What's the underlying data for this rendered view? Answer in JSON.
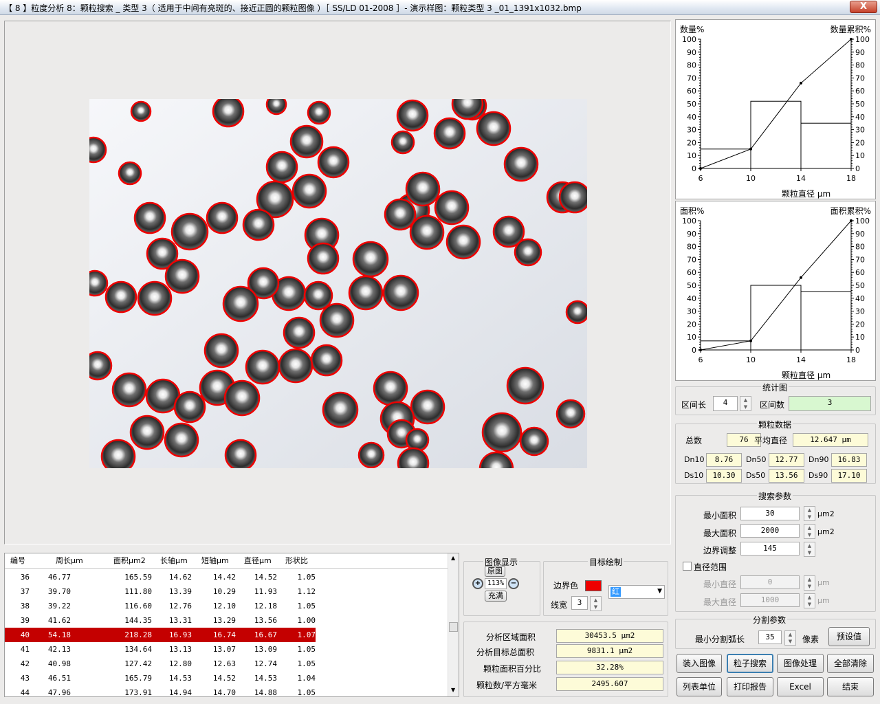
{
  "window": {
    "title": "【 8 】粒度分析 8：颗粒搜索 _ 类型 3（ 适用于中间有亮斑的、接近正圆的颗粒图像 ）［  SS/LD 01-2008  ］- 演示样图：颗粒类型 3 _01_1391x1032.bmp",
    "close": "X"
  },
  "charts": {
    "count": {
      "ylabel_left": "数量%",
      "ylabel_right": "数量累积%",
      "xlabel": "颗粒直径  μm"
    },
    "area": {
      "ylabel_left": "面积%",
      "ylabel_right": "面积累积%",
      "xlabel": "颗粒直径  μm"
    }
  },
  "chart_data": [
    {
      "type": "bar",
      "x_edges": [
        6,
        10,
        14,
        18
      ],
      "values": [
        15,
        52,
        35
      ],
      "cumulative": [
        0,
        15,
        66,
        100
      ],
      "xlim": [
        6,
        18
      ],
      "ylim": [
        0,
        100
      ],
      "xticks": [
        "6",
        "10",
        "14",
        "18"
      ],
      "yticks": [
        "0",
        "10",
        "20",
        "30",
        "40",
        "50",
        "60",
        "70",
        "80",
        "90",
        "100"
      ]
    },
    {
      "type": "bar",
      "x_edges": [
        6,
        10,
        14,
        18
      ],
      "values": [
        7,
        50,
        45
      ],
      "cumulative": [
        0,
        7,
        56,
        100
      ],
      "xlim": [
        6,
        18
      ],
      "ylim": [
        0,
        100
      ],
      "xticks": [
        "6",
        "10",
        "14",
        "18"
      ],
      "yticks": [
        "0",
        "10",
        "20",
        "30",
        "40",
        "50",
        "60",
        "70",
        "80",
        "90",
        "100"
      ]
    }
  ],
  "stats": {
    "title": "统计图",
    "interval_label": "区间长",
    "interval_value": "4",
    "count_label": "区间数",
    "count_value": "3"
  },
  "particle": {
    "title": "颗粒数据",
    "total_label": "总数",
    "total_value": "76",
    "mean_label": "平均直径",
    "mean_value": "12.647  μm",
    "dn10_label": "Dn10",
    "dn10": "8.76",
    "dn50_label": "Dn50",
    "dn50": "12.77",
    "dn90_label": "Dn90",
    "dn90": "16.83",
    "ds10_label": "Ds10",
    "ds10": "10.30",
    "ds50_label": "Ds50",
    "ds50": "13.56",
    "ds90_label": "Ds90",
    "ds90": "17.10"
  },
  "search": {
    "title": "搜索参数",
    "min_area_label": "最小面积",
    "min_area": "30",
    "max_area_label": "最大面积",
    "max_area": "2000",
    "area_unit": "μm2",
    "edge_label": "边界调整",
    "edge": "145",
    "range_label": "直径范围",
    "min_d_label": "最小直径",
    "min_d": "0",
    "max_d_label": "最大直径",
    "max_d": "1000",
    "d_unit": "μm"
  },
  "split": {
    "title": "分割参数",
    "label": "最小分割弧长",
    "value": "35",
    "unit": "像素",
    "preset": "预设值"
  },
  "buttons": {
    "load": "装入图像",
    "search": "粒子搜索",
    "process": "图像处理",
    "clear": "全部清除",
    "unit": "列表单位",
    "print": "打印报告",
    "excel": "Excel",
    "end": "结束"
  },
  "imgdisplay": {
    "title": "图像显示",
    "original": "原图",
    "zoom": "113%",
    "fill": "充满"
  },
  "target": {
    "title": "目标绘制",
    "border_color": "边界色",
    "line_width": "线宽",
    "line_width_value": "3",
    "color_name": "红"
  },
  "summary": {
    "area_label": "分析区域面积",
    "area": "30453.5  μm2",
    "target_label": "分析目标总面积",
    "target": "9831.1  μm2",
    "pct_label": "颗粒面积百分比",
    "pct": "32.28%",
    "density_label": "颗粒数/平方毫米",
    "density": "2495.607"
  },
  "table": {
    "headers": [
      "编号",
      "周长μm",
      "面积μm2",
      "长轴μm",
      "短轴μm",
      "直径μm",
      "形状比"
    ],
    "rows": [
      [
        "36",
        "46.77",
        "165.59",
        "14.62",
        "14.42",
        "14.52",
        "1.05"
      ],
      [
        "37",
        "39.70",
        "111.80",
        "13.39",
        "10.29",
        "11.93",
        "1.12"
      ],
      [
        "38",
        "39.22",
        "116.60",
        "12.76",
        "12.10",
        "12.18",
        "1.05"
      ],
      [
        "39",
        "41.62",
        "144.35",
        "13.31",
        "13.29",
        "13.56",
        "1.00"
      ],
      [
        "40",
        "54.18",
        "218.28",
        "16.93",
        "16.74",
        "16.67",
        "1.07"
      ],
      [
        "41",
        "42.13",
        "134.64",
        "13.13",
        "13.07",
        "13.09",
        "1.05"
      ],
      [
        "42",
        "40.98",
        "127.42",
        "12.80",
        "12.63",
        "12.74",
        "1.05"
      ],
      [
        "43",
        "46.51",
        "165.79",
        "14.53",
        "14.52",
        "14.53",
        "1.04"
      ],
      [
        "44",
        "47.96",
        "173.91",
        "14.94",
        "14.70",
        "14.88",
        "1.05"
      ]
    ],
    "highlight_index": 4
  },
  "colors": {
    "highlight": "#c40000",
    "boundary": "#ee0000",
    "field_yellow": "#fdfbd8",
    "field_green": "#d8f7d0"
  }
}
